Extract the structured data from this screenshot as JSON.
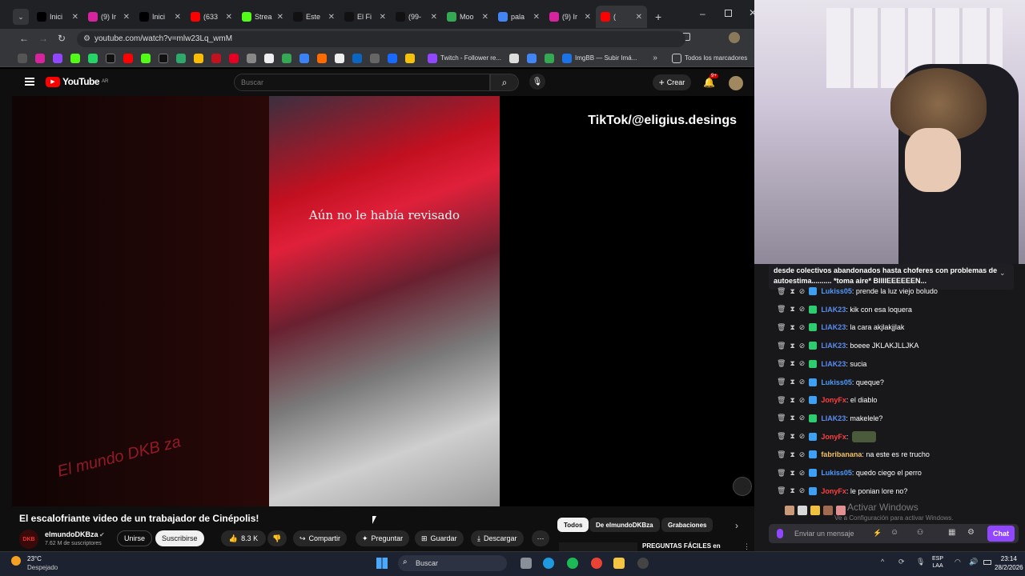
{
  "browser": {
    "tabs": [
      {
        "label": "Inici",
        "color": "#000000"
      },
      {
        "label": "(9) Ir",
        "color": "#d6249f"
      },
      {
        "label": "Inici",
        "color": "#000000"
      },
      {
        "label": "(633",
        "color": "#ff0000"
      },
      {
        "label": "Strea",
        "color": "#53fc18"
      },
      {
        "label": "Este",
        "color": "#111111"
      },
      {
        "label": "El Fi",
        "color": "#111111"
      },
      {
        "label": "(99-",
        "color": "#111111"
      },
      {
        "label": "Moo",
        "color": "#34a853"
      },
      {
        "label": "pala",
        "color": "#4285f4"
      },
      {
        "label": "(9) Ir",
        "color": "#d6249f"
      },
      {
        "label": "(",
        "color": "#ff0000"
      }
    ],
    "url": "youtube.com/watch?v=mlw23Lq_wmM",
    "bookmarks": {
      "twitch": "Twitch - Follower re...",
      "imgbb": "ImgBB — Subir Imá...",
      "all": "Todos los marcadores"
    }
  },
  "youtube": {
    "logo": "YouTube",
    "region": "AR",
    "search_placeholder": "Buscar",
    "create": "Crear",
    "notif_count": "9+",
    "video": {
      "subtitle": "Aún no le había revisado",
      "overlay": "TikTok/@eligius.desings",
      "watermark": "El mundo DKB za"
    },
    "title": "El escalofriante video de un trabajador de Cinépolis!",
    "channel": {
      "name": "elmundoDKBza",
      "subs": "7.62 M de suscriptores",
      "avatar": "DKB"
    },
    "buttons": {
      "join": "Unirse",
      "subscribe": "Suscribirse",
      "likes": "8.3 K",
      "share": "Compartir",
      "ask": "Preguntar",
      "save": "Guardar",
      "download": "Descargar"
    },
    "chips": [
      "Todos",
      "De elmundoDKBza",
      "Grabaciones"
    ],
    "rec": "PREGUNTAS FÁCILES en"
  },
  "chat": {
    "pinned": "desde colectivos abandonados hasta choferes con problemas de autoestima.......... *toma aire* BIIIIEEEEEEN...",
    "messages": [
      {
        "user": "Lukiss05",
        "text": ": prende la luz viejo boludo",
        "color": "#4f9bff"
      },
      {
        "user": "LIAK23",
        "text": ": kik con esa loquera",
        "color": "#5b8def"
      },
      {
        "user": "LIAK23",
        "text": ": la cara akjlakjjlak",
        "color": "#5b8def"
      },
      {
        "user": "LIAK23",
        "text": ": boeee JKLAKJLLJKA",
        "color": "#5b8def"
      },
      {
        "user": "LIAK23",
        "text": ": sucia",
        "color": "#5b8def"
      },
      {
        "user": "Lukiss05",
        "text": ": queque?",
        "color": "#4f9bff"
      },
      {
        "user": "JonyFx",
        "text": ": el diablo",
        "color": "#ff4040"
      },
      {
        "user": "LIAK23",
        "text": ": makelele?",
        "color": "#5b8def"
      },
      {
        "user": "JonyFx",
        "text": ":",
        "color": "#ff4040"
      },
      {
        "user": "fabribanana",
        "text": ": na este es re trucho",
        "color": "#f0c060"
      },
      {
        "user": "Lukiss05",
        "text": ": quedo ciego el perro",
        "color": "#4f9bff"
      },
      {
        "user": "JonyFx",
        "text": ": le ponian lore no?",
        "color": "#ff4040"
      }
    ],
    "windows_notice": "Activar Windows",
    "windows_sub": "Ve a Configuración para activar Windows.",
    "input_placeholder": "Enviar un mensaje",
    "chat_button": "Chat"
  },
  "taskbar": {
    "weather_temp": "23°C",
    "weather_desc": "Despejado",
    "search": "Buscar",
    "lang": "ESP",
    "lang2": "LAA",
    "time": "23:14",
    "date": "28/2/2026"
  }
}
